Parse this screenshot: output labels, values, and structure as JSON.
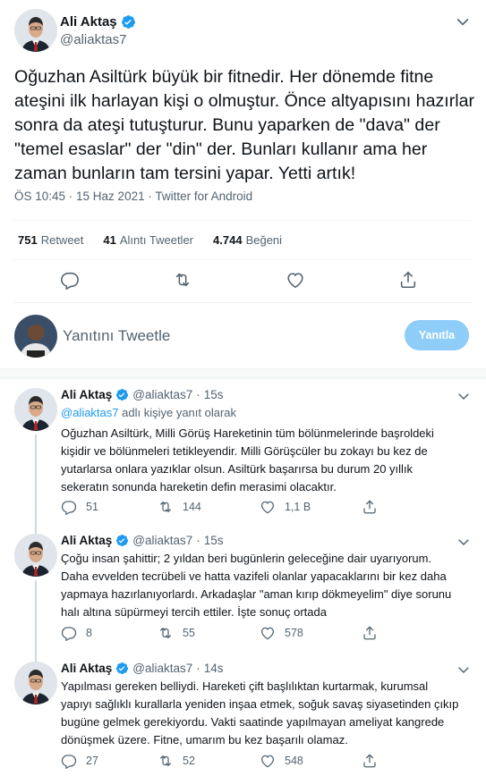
{
  "main_tweet": {
    "name": "Ali Aktaş",
    "handle": "@aliaktas7",
    "text": "Oğuzhan Asiltürk büyük bir fitnedir. Her dönemde fitne ateşini ilk harlayan kişi o olmuştur. Önce altyapısını hazırlar sonra da ateşi tutuşturur. Bunu yaparken de \"dava\" der \"temel esaslar\" der \"din\" der. Bunları kullanır ama her zaman bunların tam tersini yapar. Yetti artık!",
    "meta": "ÖS 10:45 · 15 Haz 2021 · Twitter for Android",
    "stats": {
      "retweets_count": "751",
      "retweets_label": "Retweet",
      "quotes_count": "41",
      "quotes_label": "Alıntı Tweetler",
      "likes_count": "4.744",
      "likes_label": "Beğeni"
    }
  },
  "reply_composer": {
    "placeholder": "Yanıtını Tweetle",
    "button_label": "Yanıtla"
  },
  "replies": [
    {
      "name": "Ali Aktaş",
      "handle": "@aliaktas7",
      "time": "15s",
      "replying_to_link": "@aliaktas7",
      "replying_to_text": "adlı kişiye yanıt olarak",
      "lines": [
        "Oğuzhan Asiltürk, Milli Görüş Hareketinin tüm bölünmelerinde başroldeki",
        "kişidir ve bölünmeleri tetikleyendir. Milli Görüşcüler bu zokayı bu kez de",
        "yutarlarsa onlara yazıklar olsun. Asiltürk başarırsa bu durum 20 yıllık",
        "sekeratın sonunda hareketin defin merasimi olacaktır."
      ],
      "replies": "51",
      "retweets": "144",
      "likes": "1,1 B"
    },
    {
      "name": "Ali Aktaş",
      "handle": "@aliaktas7",
      "time": "15s",
      "lines": [
        "Çoğu insan şahittir; 2 yıldan beri bugünlerin geleceğine dair uyarıyorum.",
        "Daha evvelden tecrübeli ve hatta vazifeli olanlar yapacaklarını bir kez daha",
        "yapmaya hazırlanıyorlardı. Arkadaşlar \"aman kırıp dökmeyelim\" diye sorunu",
        "halı altına süpürmeyi tercih ettiler. İşte sonuç ortada"
      ],
      "replies": "8",
      "retweets": "55",
      "likes": "578"
    },
    {
      "name": "Ali Aktaş",
      "handle": "@aliaktas7",
      "time": "14s",
      "lines": [
        "Yapılması gereken belliydi. Hareketi çift başlılıktan kurtarmak, kurumsal",
        "yapıyı sağlıklı kurallarla yeniden inşaa etmek, soğuk savaş siyasetinden çıkıp",
        "bugüne gelmek gerekiyordu. Vakti saatinde yapılmayan ameliyat kangrede",
        "dönüşmek üzere. Fitne, umarım bu kez başarılı olamaz."
      ],
      "replies": "27",
      "retweets": "52",
      "likes": "548"
    }
  ],
  "colors": {
    "accent": "#1d9bf0",
    "text_secondary": "#536471",
    "verified": "#1d9bf0",
    "reply_button": "#8ecdf8"
  },
  "icons": [
    "verified-badge-icon",
    "chevron-down-icon",
    "reply-icon",
    "retweet-icon",
    "like-icon",
    "share-icon"
  ]
}
